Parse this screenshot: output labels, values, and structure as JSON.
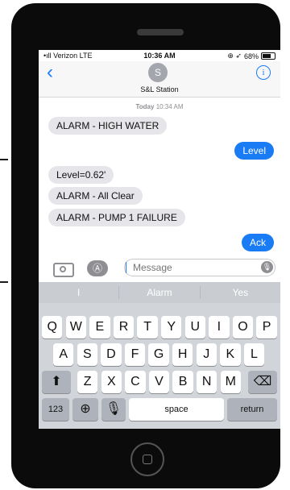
{
  "status_bar": {
    "carrier": "Verizon LTE",
    "time": "10:36 AM",
    "battery": "68%",
    "battery_fraction": 0.68
  },
  "header": {
    "avatar_initial": "S",
    "contact_name": "S&L Station",
    "back_icon": "chevron-left-icon",
    "info_icon": "info-icon"
  },
  "conversation": {
    "timestamp_day": "Today",
    "timestamp_time": "10:34 AM",
    "messages": [
      {
        "direction": "incoming",
        "text": "ALARM - HIGH WATER"
      },
      {
        "direction": "outgoing",
        "text": "Level"
      },
      {
        "direction": "incoming",
        "text": "Level=0.62'"
      },
      {
        "direction": "incoming",
        "text": "ALARM - All Clear"
      },
      {
        "direction": "incoming",
        "text": "ALARM - PUMP 1 FAILURE"
      },
      {
        "direction": "outgoing",
        "text": "Ack"
      }
    ]
  },
  "composer": {
    "placeholder": "Message",
    "camera_icon": "camera-icon",
    "apps_icon": "app-store-icon",
    "mic_icon": "microphone-icon"
  },
  "keyboard": {
    "suggestions": [
      "I",
      "Alarm",
      "Yes"
    ],
    "row1": [
      "Q",
      "W",
      "E",
      "R",
      "T",
      "Y",
      "U",
      "I",
      "O",
      "P"
    ],
    "row2": [
      "A",
      "S",
      "D",
      "F",
      "G",
      "H",
      "J",
      "K",
      "L"
    ],
    "row3": [
      "Z",
      "X",
      "C",
      "V",
      "B",
      "N",
      "M"
    ],
    "shift_icon": "shift-icon",
    "delete_icon": "delete-icon",
    "numbers_label": "123",
    "globe_icon": "globe-icon",
    "dictation_icon": "microphone-icon",
    "space_label": "space",
    "return_label": "return"
  },
  "colors": {
    "imessage_blue": "#1a7cf5",
    "incoming_gray": "#e5e5ea",
    "keyboard_bg": "#d1d4d9"
  }
}
